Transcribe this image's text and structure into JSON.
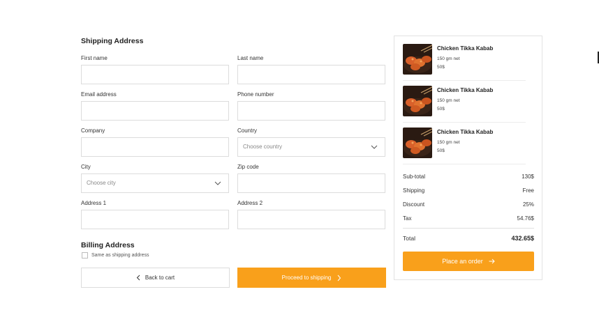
{
  "shipping": {
    "title": "Shipping Address",
    "first_name": {
      "label": "First name",
      "value": ""
    },
    "last_name": {
      "label": "Last name",
      "value": ""
    },
    "email": {
      "label": "Email address",
      "value": ""
    },
    "phone": {
      "label": "Phone number",
      "value": ""
    },
    "company": {
      "label": "Company",
      "value": ""
    },
    "country": {
      "label": "Country",
      "placeholder": "Choose country"
    },
    "city": {
      "label": "City",
      "placeholder": "Choose city"
    },
    "zip": {
      "label": "Zip code",
      "value": ""
    },
    "address1": {
      "label": "Address 1",
      "value": ""
    },
    "address2": {
      "label": "Address 2",
      "value": ""
    }
  },
  "billing": {
    "title": "Billing Address",
    "same_as_shipping_label": "Same as shipping address",
    "same_as_shipping_checked": false
  },
  "actions": {
    "back_label": "Back to cart",
    "proceed_label": "Proceed to shipping"
  },
  "order": {
    "items": [
      {
        "name": "Chicken Tikka Kabab",
        "weight": "150 gm net",
        "price": "50$"
      },
      {
        "name": "Chicken Tikka Kabab",
        "weight": "150 gm net",
        "price": "50$"
      },
      {
        "name": "Chicken Tikka Kabab",
        "weight": "150 gm net",
        "price": "50$"
      }
    ],
    "subtotal": {
      "label": "Sub-total",
      "value": "130$"
    },
    "shipping": {
      "label": "Shipping",
      "value": "Free"
    },
    "discount": {
      "label": "Discount",
      "value": "25%"
    },
    "tax": {
      "label": "Tax",
      "value": "54.76$"
    },
    "total": {
      "label": "Total",
      "value": "432.65$"
    },
    "place_order_label": "Place an order"
  },
  "colors": {
    "accent": "#f9a01b",
    "border": "#dcdcdc",
    "text": "#222222"
  },
  "icons": {
    "select_chevron": "chevron-down-icon",
    "back": "chevron-left-icon",
    "proceed": "chevron-right-icon",
    "place_order": "arrow-right-icon"
  }
}
